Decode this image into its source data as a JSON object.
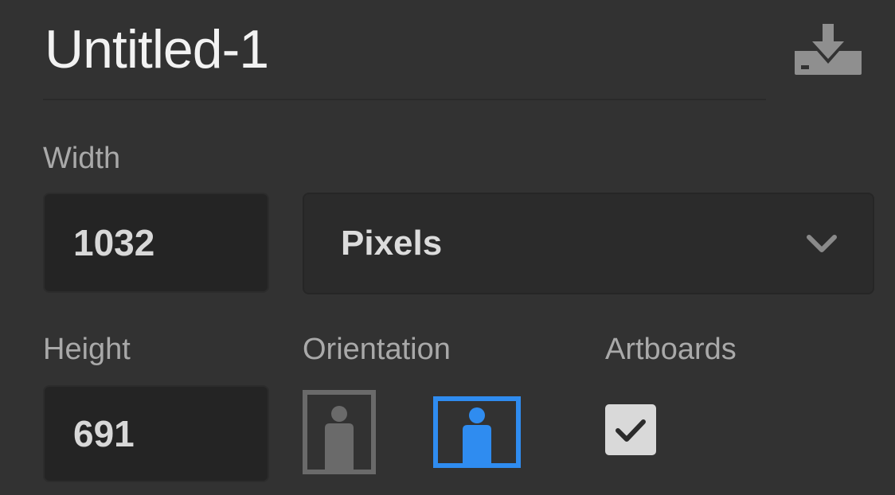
{
  "document": {
    "title": "Untitled-1"
  },
  "icons": {
    "save": "download-tray-icon",
    "dropdown": "chevron-down-icon",
    "portrait": "portrait-orientation-icon",
    "landscape": "landscape-orientation-icon",
    "checkmark": "checkmark-icon"
  },
  "width": {
    "label": "Width",
    "value": "1032"
  },
  "units": {
    "selected": "Pixels"
  },
  "height": {
    "label": "Height",
    "value": "691"
  },
  "orientation": {
    "label": "Orientation",
    "selected": "landscape"
  },
  "artboards": {
    "label": "Artboards",
    "checked": true
  },
  "colors": {
    "background": "#323232",
    "accent": "#2f8cf0",
    "inactive_icon": "#6a6a6a"
  }
}
